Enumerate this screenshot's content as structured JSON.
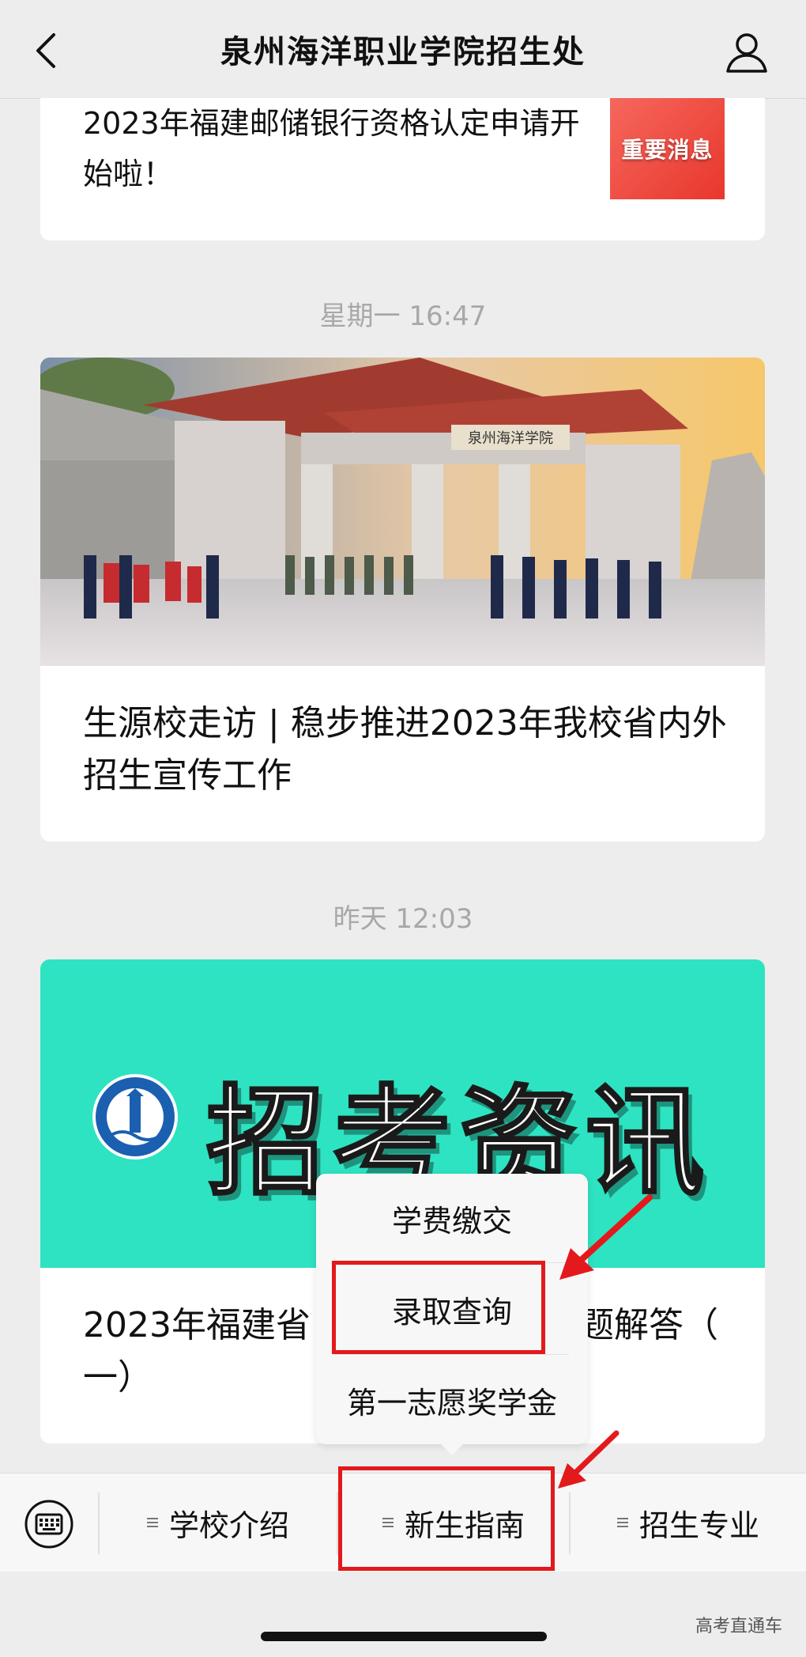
{
  "header": {
    "title": "泉州海洋职业学院招生处"
  },
  "articles": [
    {
      "title": "2023年福建邮储银行资格认定申请开始啦！",
      "thumb_text": "重要消息"
    },
    {
      "time": "星期一 16:47",
      "title": "生源校走访 | 稳步推进2023年我校省内外招生宣传工作",
      "gate_plaque": "泉州海洋学院"
    },
    {
      "time": "昨天 12:03",
      "banner_text": "招考资讯",
      "title_left": "2023年福建省",
      "title_right": "题解答（",
      "title_line2": "一）"
    }
  ],
  "popup_menu": {
    "items": [
      "学费缴交",
      "录取查询",
      "第一志愿奖学金"
    ]
  },
  "menu_bar": {
    "items": [
      "学校介绍",
      "新生指南",
      "招生专业"
    ]
  },
  "watermark": "高考直通车",
  "colors": {
    "accent_red": "#e3191c",
    "banner_teal": "#2ee3c2"
  }
}
